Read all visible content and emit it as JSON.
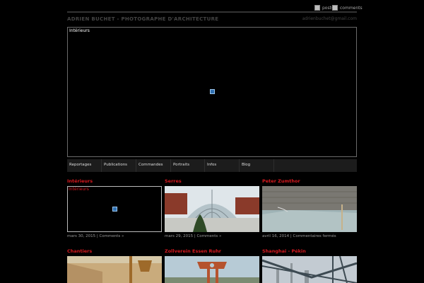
{
  "header": {
    "feed_posts": "posts",
    "feed_comments": "comments",
    "site_title": "ADRIEN BUCHET - PHOTOGRAPHE D'ARCHITECTURE",
    "email": "adrienbuchet@gmail.com"
  },
  "hero": {
    "label": "Intérieurs"
  },
  "nav": [
    {
      "label": "Reportages"
    },
    {
      "label": "Publications"
    },
    {
      "label": "Commandes"
    },
    {
      "label": "Portraits"
    },
    {
      "label": "Infos"
    },
    {
      "label": "Blog"
    }
  ],
  "posts": [
    {
      "title": "Intérieurs",
      "image_label": "Intérieurs",
      "date": "mars 30, 2015",
      "comments": "Comments »"
    },
    {
      "title": "Serres",
      "date": "mars 29, 2015",
      "comments": "Comments »"
    },
    {
      "title": "Peter Zumthor",
      "date": "avril 16, 2014",
      "comments": "Commentaires fermés"
    },
    {
      "title": "Chantiers"
    },
    {
      "title": "Zollverein Essen Ruhr"
    },
    {
      "title": "Shanghai - Pékin"
    }
  ],
  "colors": {
    "accent": "#d8191f",
    "background": "#000000",
    "nav_bg": "#1c1c1c"
  },
  "icons": {
    "feed": "rss-icon",
    "media_placeholder": "missing-media-icon"
  }
}
